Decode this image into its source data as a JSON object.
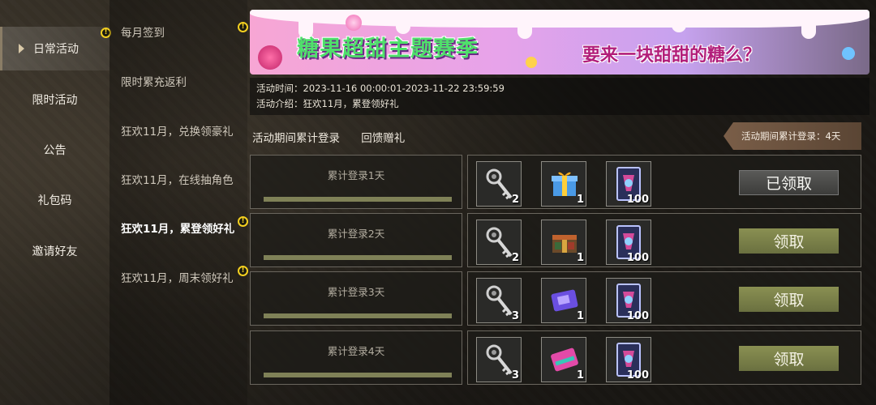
{
  "left_nav": {
    "items": [
      {
        "label": "日常活动",
        "active": true,
        "warn": true
      },
      {
        "label": "限时活动",
        "active": false,
        "warn": false
      },
      {
        "label": "公告",
        "active": false,
        "warn": false
      },
      {
        "label": "礼包码",
        "active": false,
        "warn": false
      },
      {
        "label": "邀请好友",
        "active": false,
        "warn": false
      }
    ]
  },
  "mid_nav": {
    "items": [
      {
        "label": "每月签到",
        "active": false,
        "warn": true
      },
      {
        "label": "限时累充返利",
        "active": false,
        "warn": false
      },
      {
        "label": "狂欢11月，兑换领豪礼",
        "active": false,
        "warn": false
      },
      {
        "label": "狂欢11月，在线抽角色",
        "active": false,
        "warn": false
      },
      {
        "label": "狂欢11月，累登领好礼",
        "active": true,
        "warn": true
      },
      {
        "label": "狂欢11月，周末领好礼",
        "active": false,
        "warn": true
      }
    ]
  },
  "banner": {
    "title": "糖果超甜主题赛季",
    "subtitle": "要来一块甜甜的糖么？"
  },
  "info": {
    "time": "活动时间：2023-11-16 00:00:01-2023-11-22 23:59:59",
    "intro": "活动介绍：狂欢11月，累登领好礼"
  },
  "tabs": [
    "活动期间累计登录",
    "回馈赠礼"
  ],
  "login_badge": "活动期间累计登录：4天",
  "colors": {
    "accent_green": "#4fe06b",
    "claim_btn": "#7a8048",
    "warn_yellow": "#f4d020"
  },
  "rows": [
    {
      "label": "累计登录1天",
      "items": [
        {
          "icon": "key-icon",
          "qty": "2"
        },
        {
          "icon": "gift-box-icon",
          "qty": "1"
        },
        {
          "icon": "card-pack-icon",
          "qty": "100"
        }
      ],
      "button": "已领取",
      "claimed": true
    },
    {
      "label": "累计登录2天",
      "items": [
        {
          "icon": "key-icon",
          "qty": "2"
        },
        {
          "icon": "crate-icon",
          "qty": "1"
        },
        {
          "icon": "card-pack-icon",
          "qty": "100"
        }
      ],
      "button": "领取",
      "claimed": false
    },
    {
      "label": "累计登录3天",
      "items": [
        {
          "icon": "key-icon",
          "qty": "3"
        },
        {
          "icon": "ticket-purple-icon",
          "qty": "1"
        },
        {
          "icon": "card-pack-icon",
          "qty": "100"
        }
      ],
      "button": "领取",
      "claimed": false
    },
    {
      "label": "累计登录4天",
      "items": [
        {
          "icon": "key-icon",
          "qty": "3"
        },
        {
          "icon": "ticket-pink-icon",
          "qty": "1"
        },
        {
          "icon": "card-pack-icon",
          "qty": "100"
        }
      ],
      "button": "领取",
      "claimed": false
    }
  ]
}
